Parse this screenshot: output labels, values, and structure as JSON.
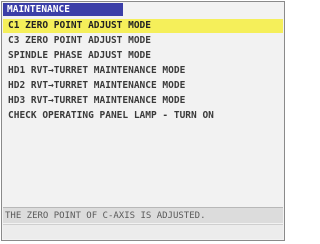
{
  "screen": {
    "title": "MAINTENANCE"
  },
  "menu": {
    "selected_index": 0,
    "items": [
      {
        "label": "C1 ZERO POINT ADJUST MODE"
      },
      {
        "label": "C3 ZERO POINT ADJUST MODE"
      },
      {
        "label": "SPINDLE PHASE ADJUST MODE"
      },
      {
        "label": "HD1 RVT→TURRET MAINTENANCE MODE"
      },
      {
        "label": "HD2 RVT→TURRET MAINTENANCE MODE"
      },
      {
        "label": "HD3 RVT→TURRET MAINTENANCE MODE"
      },
      {
        "label": "CHECK OPERATING PANEL LAMP - TURN ON"
      }
    ]
  },
  "message": {
    "text": "THE ZERO POINT OF C-AXIS IS ADJUSTED."
  },
  "colors": {
    "title_bg": "#3b3ea8",
    "selected_bg": "#f5ef5a",
    "panel_bg": "#f2f2f2"
  }
}
